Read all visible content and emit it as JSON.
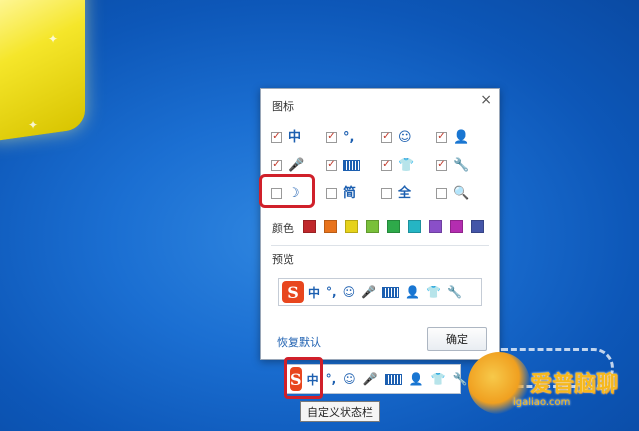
{
  "dialog": {
    "title": "图标",
    "close_label": "×",
    "icons": [
      {
        "checked": true,
        "glyph": "中",
        "icon": "chinese-mode-icon"
      },
      {
        "checked": true,
        "glyph": "°,",
        "icon": "punctuation-icon"
      },
      {
        "checked": true,
        "glyph": "☺",
        "icon": "emoji-icon"
      },
      {
        "checked": true,
        "glyph": "👤",
        "icon": "user-icon"
      },
      {
        "checked": true,
        "glyph": "🎤",
        "icon": "microphone-icon"
      },
      {
        "checked": true,
        "glyph": "",
        "icon": "keyboard-icon"
      },
      {
        "checked": true,
        "glyph": "👕",
        "icon": "skin-shirt-icon"
      },
      {
        "checked": true,
        "glyph": "🔧",
        "icon": "wrench-icon"
      },
      {
        "checked": false,
        "glyph": "☽",
        "icon": "half-width-moon-icon"
      },
      {
        "checked": false,
        "glyph": "简",
        "icon": "simplified-icon"
      },
      {
        "checked": false,
        "glyph": "全",
        "icon": "full-width-icon"
      },
      {
        "checked": false,
        "glyph": "🔍",
        "icon": "search-icon"
      }
    ],
    "color_label": "颜色",
    "colors": [
      "#c0282c",
      "#e8731c",
      "#e6d21a",
      "#79c03a",
      "#2eaa4a",
      "#25b5c4",
      "#8a4fc8",
      "#b42db0",
      "#4455a8"
    ],
    "preview_label": "预览",
    "preview_items": [
      "中",
      "°,",
      "☺",
      "🎤",
      "",
      "👤",
      "👕",
      "🔧"
    ],
    "restore_label": "恢复默认",
    "ok_label": "确定"
  },
  "statusbar": {
    "logo": "S",
    "items": [
      "中",
      "°,",
      "☺",
      "🎤",
      "",
      "👤",
      "👕",
      "🔧"
    ],
    "tooltip": "自定义状态栏"
  },
  "watermark": {
    "text": "爱普脑聊",
    "url": "igaliao.com"
  }
}
